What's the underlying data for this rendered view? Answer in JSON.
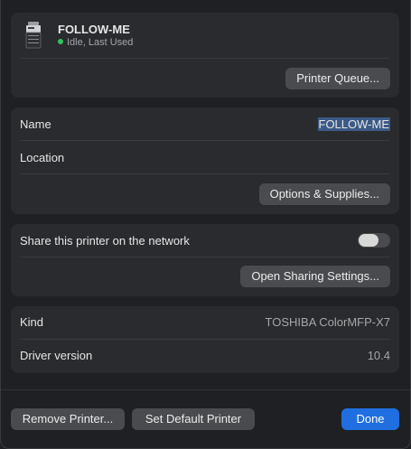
{
  "header": {
    "printer_name": "FOLLOW-ME",
    "status": "Idle, Last Used",
    "status_color": "#32c35a",
    "icon": "printer-icon",
    "queue_button": "Printer Queue..."
  },
  "info": {
    "name_label": "Name",
    "name_value": "FOLLOW-ME",
    "location_label": "Location",
    "location_value": "",
    "options_button": "Options & Supplies..."
  },
  "sharing": {
    "share_label": "Share this printer on the network",
    "share_enabled": false,
    "open_settings_button": "Open Sharing Settings..."
  },
  "details": {
    "kind_label": "Kind",
    "kind_value": "TOSHIBA ColorMFP-X7",
    "driver_label": "Driver version",
    "driver_value": "10.4"
  },
  "footer": {
    "remove_button": "Remove Printer...",
    "default_button": "Set Default Printer",
    "done_button": "Done"
  },
  "colors": {
    "accent": "#1f6fe0",
    "selection": "#3b5a86"
  }
}
